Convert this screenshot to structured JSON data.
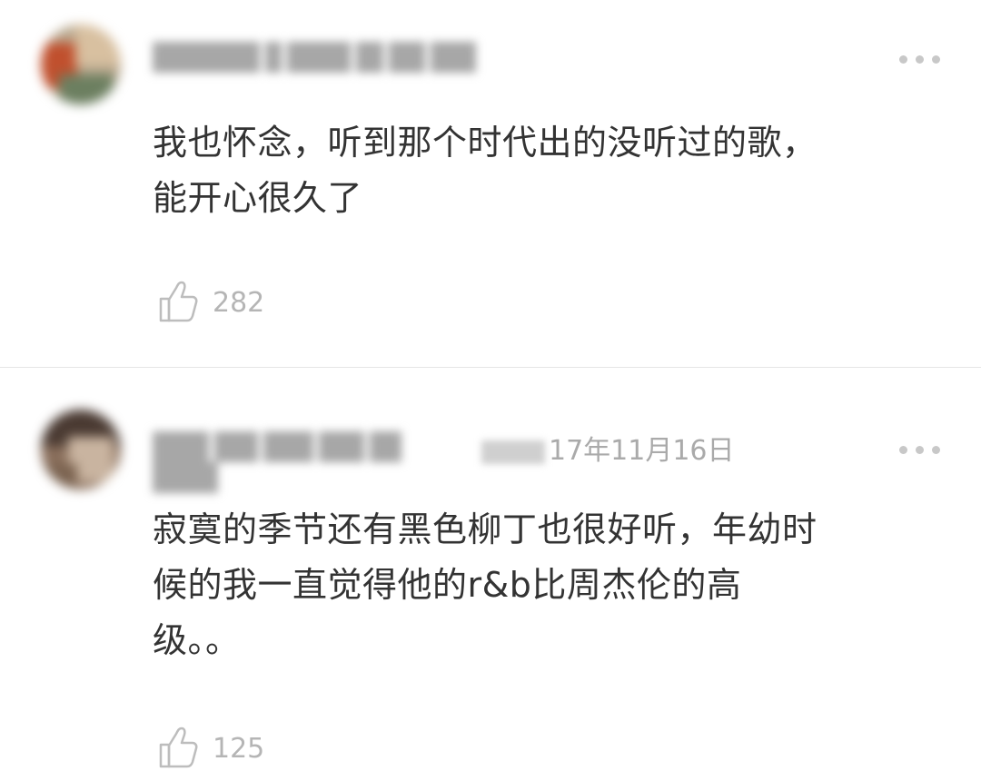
{
  "comments": [
    {
      "text_lines": [
        "我也怀念，听到那个时代出的没听过的歌，",
        "能开心很久了"
      ],
      "likes": "282",
      "like_icon": "thumbs-up-icon",
      "more_icon": "more-dots-icon"
    },
    {
      "timestamp": "17年11月16日",
      "text_lines": [
        "寂寞的季节还有黑色柳丁也很好听，年幼时",
        "候的我一直觉得他的r&b比周杰伦的高",
        "级。。"
      ],
      "likes": "125",
      "like_icon": "thumbs-up-icon",
      "more_icon": "more-dots-icon"
    }
  ],
  "colors": {
    "text": "#333333",
    "muted": "#b5b5b5",
    "divider": "#e6e6e6"
  }
}
